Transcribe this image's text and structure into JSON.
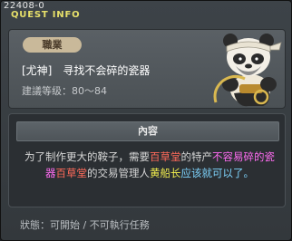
{
  "window": {
    "quest_id": "22408-0",
    "title_label": "QUEST INFO",
    "close_icon": "close-icon"
  },
  "quest": {
    "job_badge": "職業",
    "name": "[尤神]　寻找不会碎的瓷器",
    "level": "建議等级：80～84"
  },
  "npc": {
    "icon": "panda-npc-icon"
  },
  "content": {
    "header": "內容",
    "description": [
      {
        "text": "为了制作更大的鞍子，需要",
        "color": "normal"
      },
      {
        "text": "百草堂",
        "color": "red"
      },
      {
        "text": "的特产",
        "color": "normal"
      },
      {
        "text": "不容易碎的瓷器",
        "color": "magenta"
      },
      {
        "text": "百草堂",
        "color": "red"
      },
      {
        "text": "的交易管理人",
        "color": "normal"
      },
      {
        "text": "黄船长",
        "color": "yellow"
      },
      {
        "text": "应该就可以了。",
        "color": "cyan"
      }
    ]
  },
  "status": {
    "text": "狀態：可開始 / 不可執行任務"
  },
  "colors": {
    "title": "#e7e06a",
    "red": "#ff6a5a",
    "magenta": "#ff6cf2",
    "yellow": "#f2ee4e",
    "cyan": "#7fd6ff"
  }
}
